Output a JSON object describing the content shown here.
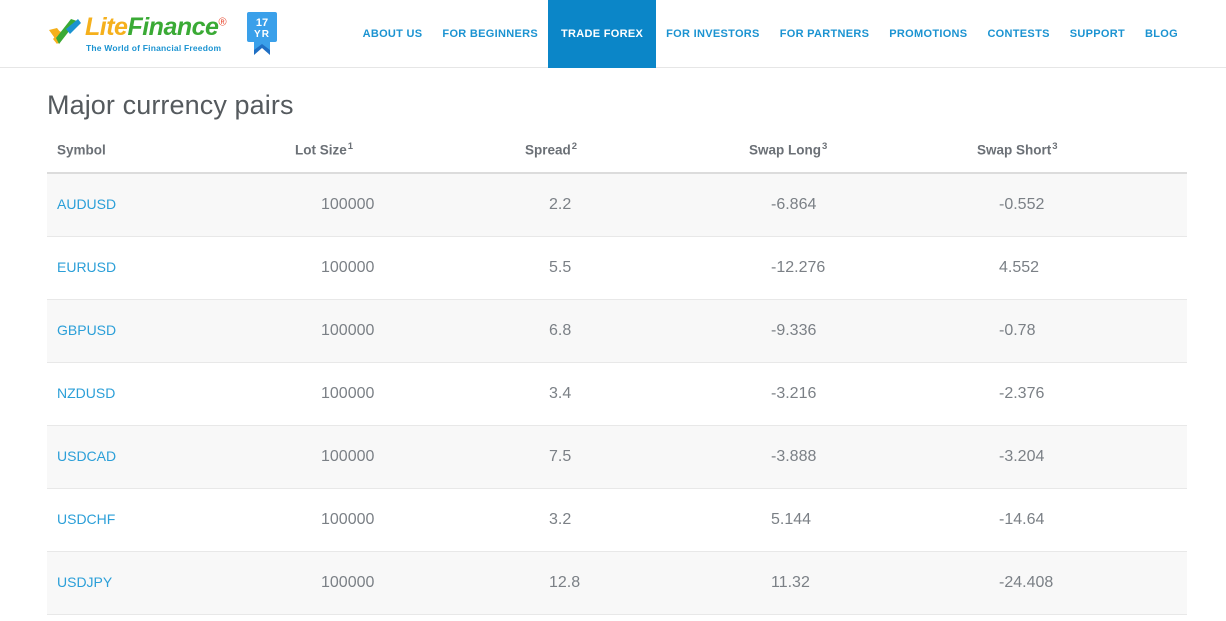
{
  "header": {
    "logo": {
      "word_lite": "Lite",
      "word_finance": "Finance",
      "registered_mark": "®",
      "tagline": "The World of Financial Freedom",
      "mark_icon": "checkmark-arrow-logo-icon"
    },
    "anniversary_badge": {
      "line1": "17",
      "line2": "YR",
      "icon": "anniversary-ribbon-badge-icon"
    },
    "nav": [
      {
        "label": "ABOUT US",
        "active": false
      },
      {
        "label": "FOR BEGINNERS",
        "active": false
      },
      {
        "label": "TRADE FOREX",
        "active": true
      },
      {
        "label": "FOR INVESTORS",
        "active": false
      },
      {
        "label": "FOR PARTNERS",
        "active": false
      },
      {
        "label": "PROMOTIONS",
        "active": false
      },
      {
        "label": "CONTESTS",
        "active": false
      },
      {
        "label": "SUPPORT",
        "active": false
      },
      {
        "label": "BLOG",
        "active": false
      }
    ]
  },
  "main": {
    "page_title": "Major currency pairs",
    "table": {
      "columns": [
        {
          "label": "Symbol",
          "sup": ""
        },
        {
          "label": "Lot Size",
          "sup": "1"
        },
        {
          "label": "Spread",
          "sup": "2"
        },
        {
          "label": "Swap Long",
          "sup": "3"
        },
        {
          "label": "Swap Short",
          "sup": "3"
        }
      ],
      "rows": [
        {
          "symbol": "AUDUSD",
          "lot_size": "100000",
          "spread": "2.2",
          "swap_long": "-6.864",
          "swap_short": "-0.552"
        },
        {
          "symbol": "EURUSD",
          "lot_size": "100000",
          "spread": "5.5",
          "swap_long": "-12.276",
          "swap_short": "4.552"
        },
        {
          "symbol": "GBPUSD",
          "lot_size": "100000",
          "spread": "6.8",
          "swap_long": "-9.336",
          "swap_short": "-0.78"
        },
        {
          "symbol": "NZDUSD",
          "lot_size": "100000",
          "spread": "3.4",
          "swap_long": "-3.216",
          "swap_short": "-2.376"
        },
        {
          "symbol": "USDCAD",
          "lot_size": "100000",
          "spread": "7.5",
          "swap_long": "-3.888",
          "swap_short": "-3.204"
        },
        {
          "symbol": "USDCHF",
          "lot_size": "100000",
          "spread": "3.2",
          "swap_long": "5.144",
          "swap_short": "-14.64"
        },
        {
          "symbol": "USDJPY",
          "lot_size": "100000",
          "spread": "12.8",
          "swap_long": "11.32",
          "swap_short": "-24.408"
        }
      ]
    }
  },
  "colors": {
    "brand_blue": "#1b93d1",
    "active_nav_bg": "#0b86c8",
    "logo_yellow": "#f5b01c",
    "logo_green": "#3aaa35",
    "link_blue": "#2b9fd8",
    "row_shaded": "#f8f8f8",
    "text_gray": "#7b8086"
  }
}
